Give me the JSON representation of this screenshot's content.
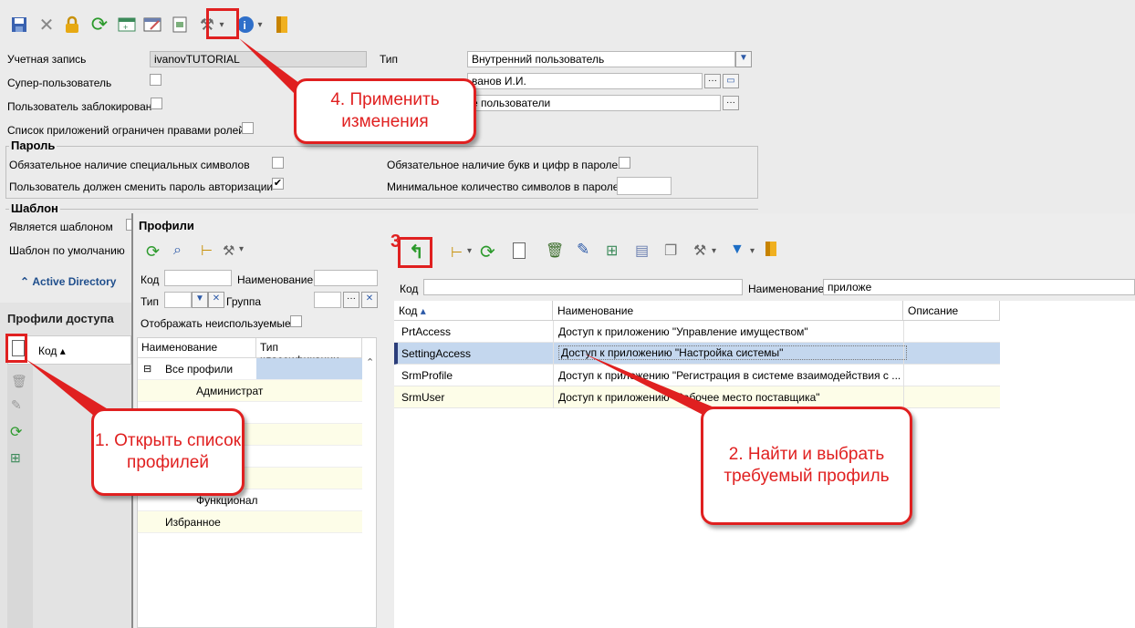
{
  "main": {
    "account_label": "Учетная запись",
    "account_value": "ivanovTUTORIAL",
    "type_label": "Тип",
    "type_value": "Внутренний пользователь",
    "superuser_label": "Супер-пользователь",
    "person_value": "ванов И.И.",
    "blocked_label": "Пользователь заблокирован",
    "group_value": "е пользователи",
    "apps_limited_label": "Список приложений ограничен правами ролей",
    "password_section": "Пароль",
    "special_chars_label": "Обязательное наличие специальных символов",
    "letters_digits_label": "Обязательное наличие букв и цифр в пароле",
    "must_change_label": "Пользователь должен сменить пароль авторизации",
    "must_change_checked": "✔",
    "min_chars_label": "Минимальное количество символов в пароле",
    "template_section": "Шаблон",
    "is_template_label": "Является шаблоном",
    "default_template_label": "Шаблон по умолчанию",
    "active_directory": "Active Directory",
    "profile_access_header": "Профили доступа",
    "code_col": "Код"
  },
  "profiles_window": {
    "title": "Профили",
    "code_label": "Код",
    "name_label": "Наименование",
    "type_label": "Тип",
    "group_label": "Группа",
    "show_unused_label": "Отображать неиспользуемые",
    "tree_headers": [
      "Наименование",
      "Тип классификации"
    ],
    "tree_items": [
      "Все профили",
      "Администрат",
      "Функционал",
      "Избранное"
    ],
    "filter_code_label": "Код",
    "filter_name_label": "Наименование",
    "filter_name_value": "приложе",
    "grid_headers": [
      "Код",
      "Наименование",
      "Описание"
    ],
    "rows": [
      {
        "code": "PrtAccess",
        "name": "Доступ к приложению \"Управление имуществом\""
      },
      {
        "code": "SettingAccess",
        "name": "Доступ к приложению \"Настройка системы\""
      },
      {
        "code": "SrmProfile",
        "name": "Доступ к приложению \"Регистрация в системе взаимодействия с ..."
      },
      {
        "code": "SrmUser",
        "name": "Доступ к приложению \"Рабочее место поставщика\""
      }
    ]
  },
  "callouts": {
    "c1": "1. Открыть список профилей",
    "c2": "2. Найти и выбрать требуемый профиль",
    "c3": "3",
    "c4": "4. Применить изменения"
  },
  "colors": {
    "accent_red": "#e02020",
    "selection": "#c4d7ee"
  }
}
